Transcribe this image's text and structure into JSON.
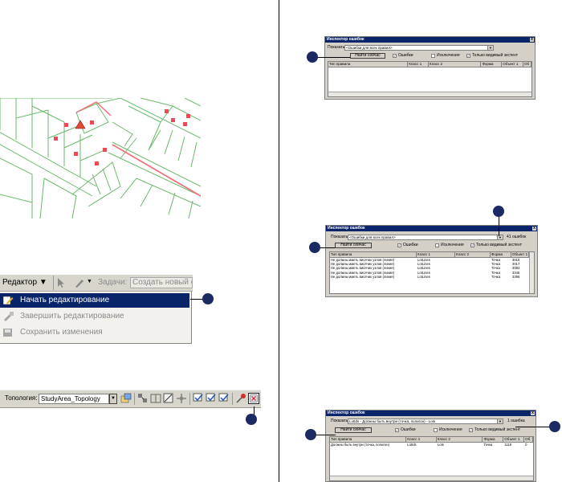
{
  "inspector": {
    "title": "Инспектор ошибок",
    "close": "x",
    "show_label": "Показать:",
    "find_now": "Найти сейчас",
    "errors": "Ошибки",
    "exceptions": "Исключения",
    "visible_extent": "Только видимый экстент",
    "check": "✓",
    "columns": [
      "Тип правила",
      "Класс 1",
      "Класс 2",
      "Форма",
      "Объект 1",
      "Об"
    ]
  },
  "inspector1": {
    "show_value": "<Ошибки для всех правил>"
  },
  "inspector2": {
    "show_value": "<Ошибки для всех правил>",
    "count": "41 ошибок",
    "rows": [
      [
        "Не должны иметь висячих узлов (линия)",
        "LotLines",
        "",
        "Точка",
        "3016"
      ],
      [
        "Не должны иметь висячих узлов (линия)",
        "LotLines",
        "",
        "Точка",
        "3017"
      ],
      [
        "Не должны иметь висячих узлов (линия)",
        "LotLines",
        "",
        "Точка",
        "3083"
      ],
      [
        "Не должны иметь висячих узлов (линия)",
        "LotLines",
        "",
        "Точка",
        "3345"
      ],
      [
        "Не должны иметь висячих узлов (линия)",
        "LotLines",
        "",
        "Точка",
        "3396"
      ]
    ]
  },
  "inspector3": {
    "show_value": "LotIds - Должны быть внутри (точка, полигон) - Lots",
    "count": "1 ошибка",
    "rows": [
      [
        "Должны быть внутри (точка, полигон)",
        "LotIds",
        "Lots",
        "Точка",
        "1119",
        "0"
      ]
    ]
  },
  "editor": {
    "menu_label": "Редактор ▼",
    "tasks_label": "Задачи:",
    "tasks_value": "Создать новый об",
    "items": [
      "Начать редактирование",
      "Завершить редактирование",
      "Сохранить изменения"
    ]
  },
  "topology": {
    "label": "Топология:",
    "value": "StudyArea_Topology"
  },
  "colors": {
    "callout": "#1c2a63",
    "highlight": "#0a246a",
    "map_lines": "#6ab96a",
    "error_line": "#f0707a",
    "error_point": "#e94b57"
  }
}
